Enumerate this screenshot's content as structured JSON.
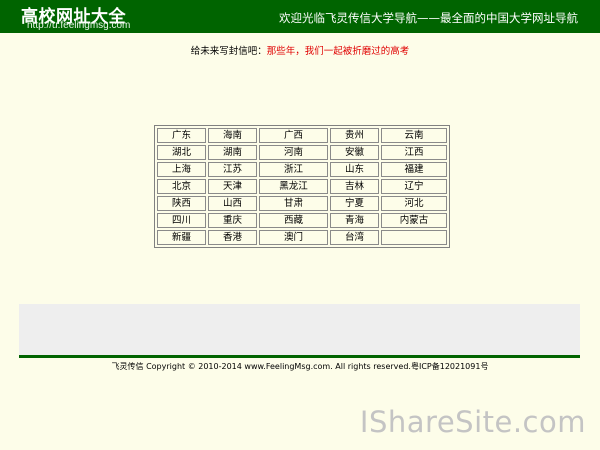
{
  "header": {
    "logo_title": "高校网址大全",
    "logo_url": "http://u.feelingmsg.com",
    "welcome": "欢迎光临飞灵传信大学导航——最全面的中国大学网址导航",
    "bg_color": "#006400"
  },
  "message": {
    "label": "给未来写封信吧：",
    "link": "那些年，我们一起被折磨过的高考",
    "link_color": "#e00000"
  },
  "provinces": [
    [
      "广东",
      "海南",
      "广西",
      "贵州",
      "云南"
    ],
    [
      "湖北",
      "湖南",
      "河南",
      "安徽",
      "江西"
    ],
    [
      "上海",
      "江苏",
      "浙江",
      "山东",
      "福建"
    ],
    [
      "北京",
      "天津",
      "黑龙江",
      "吉林",
      "辽宁"
    ],
    [
      "陕西",
      "山西",
      "甘肃",
      "宁夏",
      "河北"
    ],
    [
      "四川",
      "重庆",
      "西藏",
      "青海",
      "内蒙古"
    ],
    [
      "新疆",
      "香港",
      "澳门",
      "台湾",
      ""
    ]
  ],
  "footer": {
    "text": "飞灵传信 Copyright © 2010-2014 www.FeelingMsg.com. All rights reserved.粤ICP备12021091号"
  },
  "watermark": "IShareSite.com"
}
